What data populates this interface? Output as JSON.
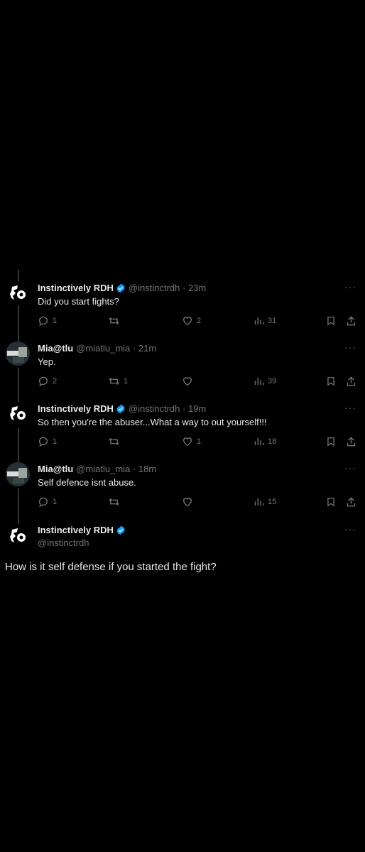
{
  "accent_color": "#1d9bf0",
  "tweets": [
    {
      "name": "Instinctively RDH",
      "handle": "@instinctrdh",
      "dot": " · ",
      "time": "23m",
      "text": "Did you start fights?",
      "replies": "1",
      "retweets": "",
      "likes": "2",
      "views": "31",
      "avatar_icon": "rdh-avatar-icon",
      "verified": true
    },
    {
      "name": "Mia@tlu",
      "handle": "@miatlu_mia",
      "dot": " · ",
      "time": "21m",
      "text": "Yep.",
      "replies": "2",
      "retweets": "1",
      "likes": "",
      "views": "39",
      "avatar_icon": "mia-avatar-icon",
      "verified": false
    },
    {
      "name": "Instinctively RDH",
      "handle": "@instinctrdh",
      "dot": " · ",
      "time": "19m",
      "text": "So then you're the abuser...What a way to out yourself!!!",
      "replies": "1",
      "retweets": "",
      "likes": "1",
      "views": "18",
      "avatar_icon": "rdh-avatar-icon",
      "verified": true
    },
    {
      "name": "Mia@tlu",
      "handle": "@miatlu_mia",
      "dot": " · ",
      "time": "18m",
      "text": "Self defence isnt abuse.",
      "replies": "1",
      "retweets": "",
      "likes": "",
      "views": "15",
      "avatar_icon": "mia-avatar-icon",
      "verified": false
    }
  ],
  "main_tweet": {
    "name": "Instinctively RDH",
    "handle": "@instinctrdh",
    "text": "How is it self defense if you started the fight?",
    "verified": true
  },
  "more_label": "···"
}
